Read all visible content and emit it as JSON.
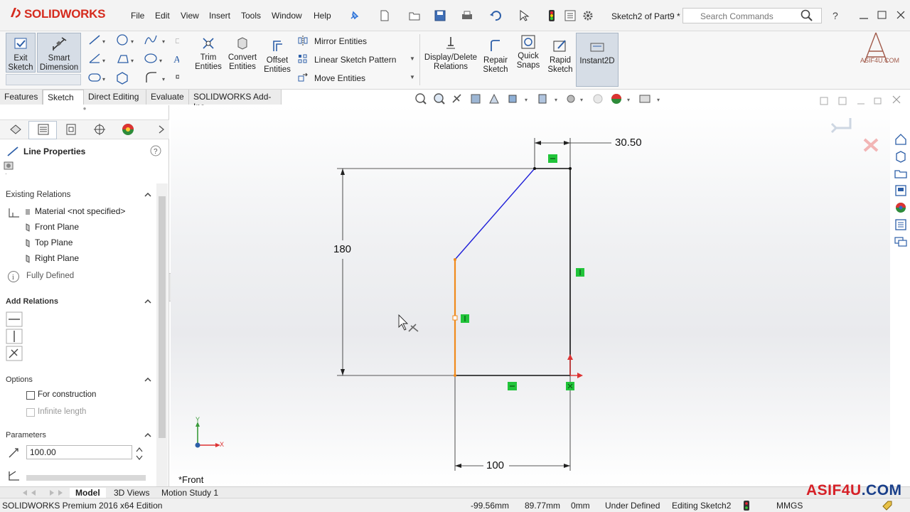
{
  "app": {
    "brand": "SOLIDWORKS",
    "document_title": "Sketch2 of Part9 *",
    "search_placeholder": "Search Commands"
  },
  "menu": [
    "File",
    "Edit",
    "View",
    "Insert",
    "Tools",
    "Window",
    "Help"
  ],
  "command_manager": {
    "exit_sketch": "Exit Sketch",
    "smart_dimension": "Smart Dimension",
    "trim_entities": "Trim Entities",
    "convert_entities": "Convert Entities",
    "offset_entities": "Offset Entities",
    "mirror_entities": "Mirror Entities",
    "linear_sketch_pattern": "Linear Sketch Pattern",
    "move_entities": "Move Entities",
    "display_delete_relations": "Display/Delete Relations",
    "repair_sketch": "Repair Sketch",
    "quick_snaps": "Quick Snaps",
    "rapid_sketch": "Rapid Sketch",
    "instant2d": "Instant2D"
  },
  "tabs": [
    "Features",
    "Sketch",
    "Direct Editing",
    "Evaluate",
    "SOLIDWORKS Add-Ins"
  ],
  "active_tab": "Sketch",
  "property_manager": {
    "title": "Line Properties",
    "existing_relations": {
      "heading": "Existing Relations",
      "items": [
        "Material <not specified>",
        "Front Plane",
        "Top Plane",
        "Right Plane"
      ],
      "status": "Fully Defined"
    },
    "add_relations": {
      "heading": "Add Relations"
    },
    "options": {
      "heading": "Options",
      "for_construction": "For construction",
      "infinite_length": "Infinite length"
    },
    "parameters": {
      "heading": "Parameters",
      "length_value": "100.00"
    }
  },
  "sketch": {
    "dim_top": "30.50",
    "dim_left": "180",
    "dim_bottom": "100",
    "view_label": "*Front",
    "axis_x": "X",
    "axis_y": "Y"
  },
  "bottom_tabs": [
    "Model",
    "3D Views",
    "Motion Study 1"
  ],
  "active_bottom_tab": "Model",
  "status_bar": {
    "edition": "SOLIDWORKS Premium 2016 x64 Edition",
    "x": "-99.56mm",
    "y": "89.77mm",
    "z": "0mm",
    "definition": "Under Defined",
    "editing": "Editing Sketch2",
    "units": "MMGS"
  },
  "watermark": {
    "text": "ASIF4U",
    "suffix": ".COM",
    "logo_text": "ASIF4U.COM"
  },
  "colors": {
    "brand_red": "#d52b1e",
    "selected_line": "#f08a1c",
    "sketch_line_blue": "#1f1fd8",
    "relation_green": "#21c43a",
    "sketch_black": "#111111"
  }
}
